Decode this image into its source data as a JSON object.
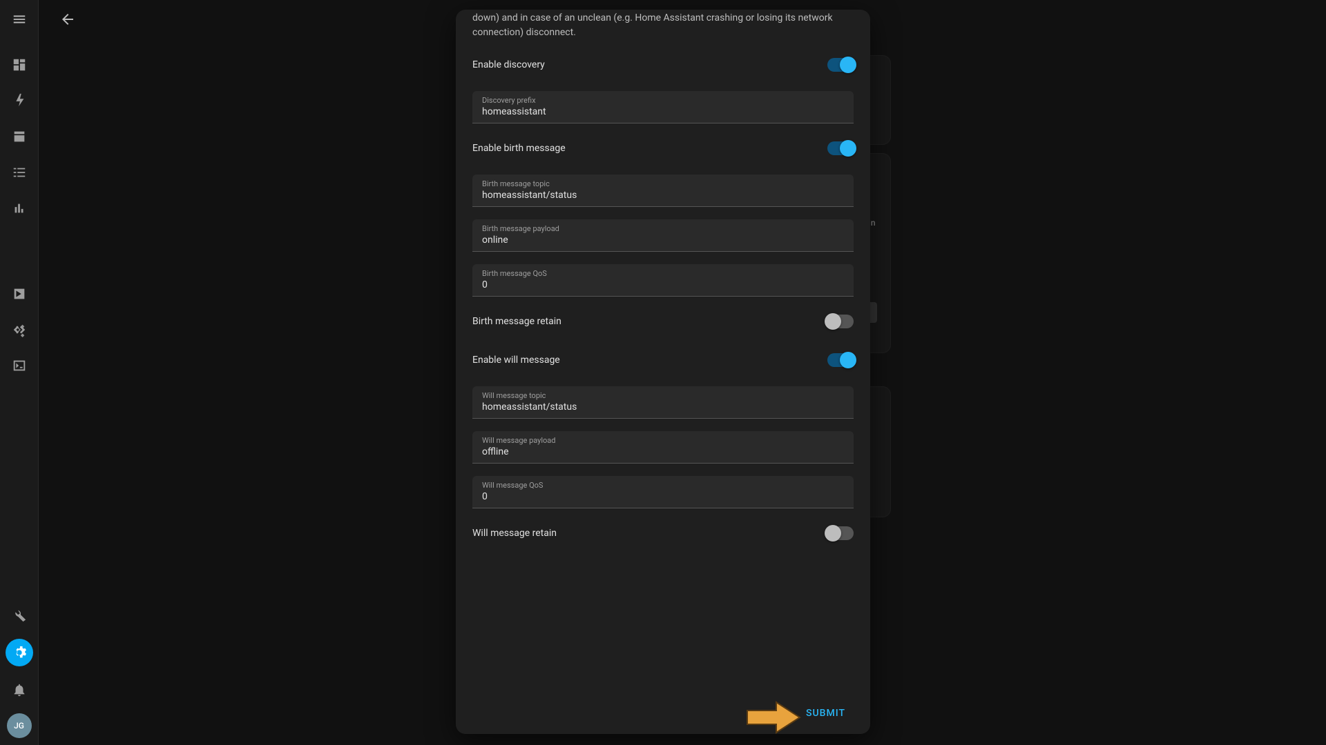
{
  "sidebar": {
    "avatar_initials": "JG"
  },
  "bg": {
    "peek_text": "in"
  },
  "dialog": {
    "intro_fragment": "down) and in case of an unclean (e.g. Home Assistant crashing or losing its network connection) disconnect.",
    "enable_discovery_label": "Enable discovery",
    "discovery_prefix_label": "Discovery prefix",
    "discovery_prefix_value": "homeassistant",
    "enable_birth_label": "Enable birth message",
    "birth_topic_label": "Birth message topic",
    "birth_topic_value": "homeassistant/status",
    "birth_payload_label": "Birth message payload",
    "birth_payload_value": "online",
    "birth_qos_label": "Birth message QoS",
    "birth_qos_value": "0",
    "birth_retain_label": "Birth message retain",
    "enable_will_label": "Enable will message",
    "will_topic_label": "Will message topic",
    "will_topic_value": "homeassistant/status",
    "will_payload_label": "Will message payload",
    "will_payload_value": "offline",
    "will_qos_label": "Will message QoS",
    "will_qos_value": "0",
    "will_retain_label": "Will message retain",
    "submit_label": "SUBMIT"
  }
}
